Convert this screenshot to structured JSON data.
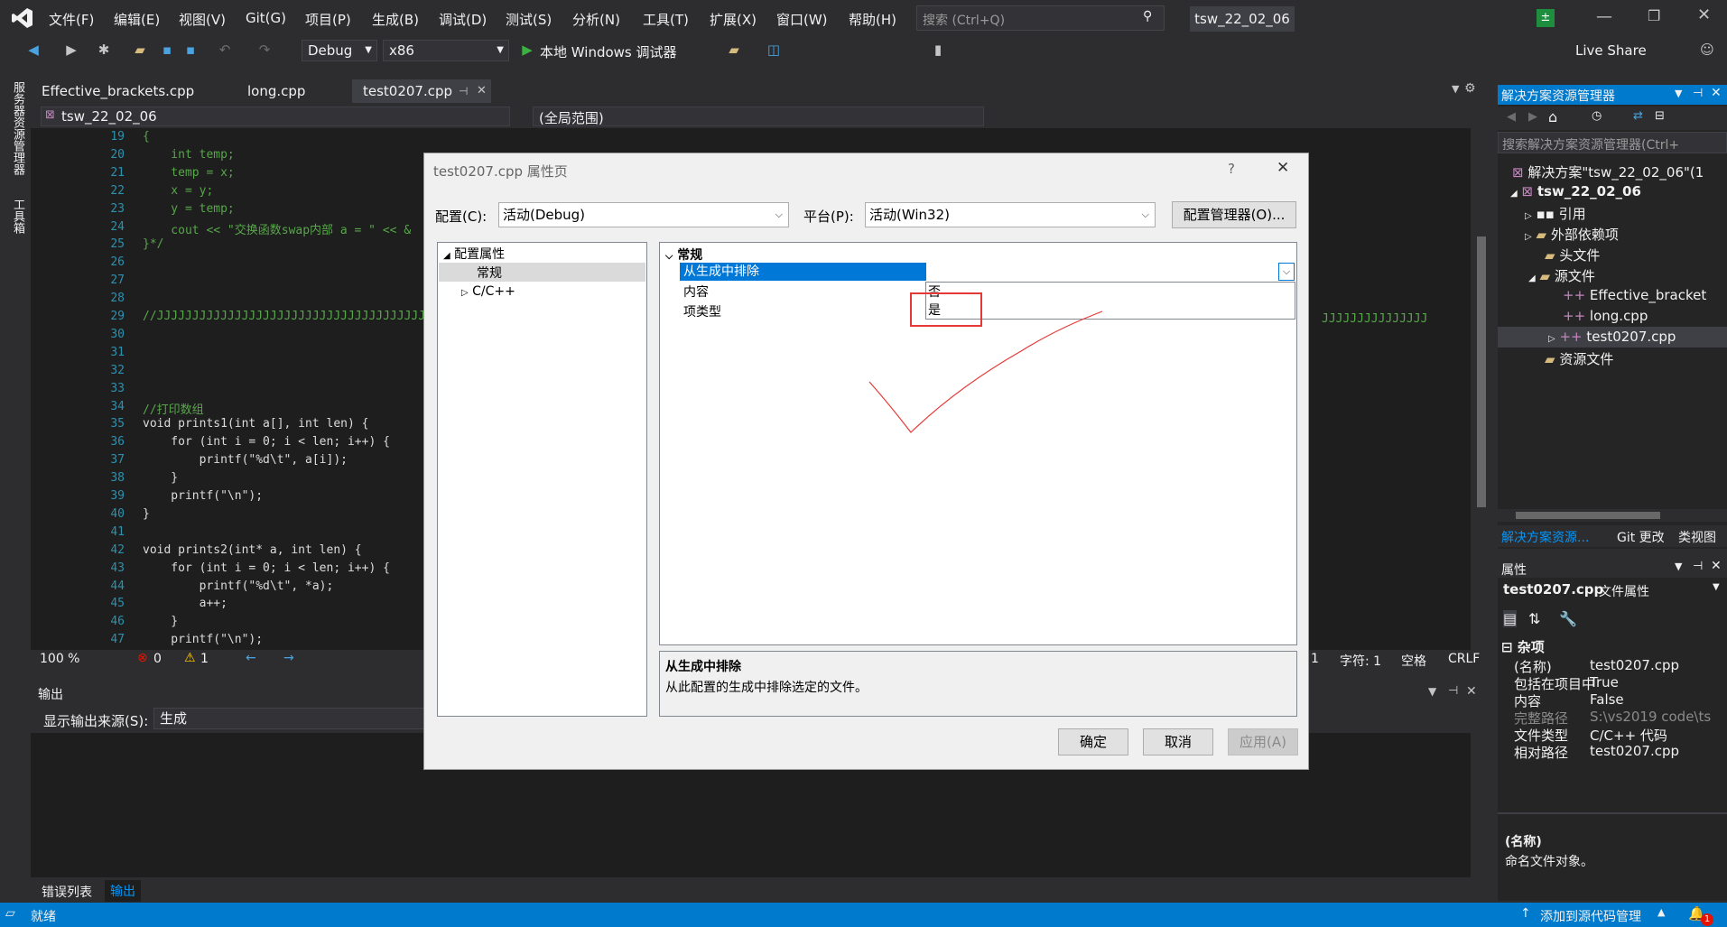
{
  "menu": [
    "文件(F)",
    "编辑(E)",
    "视图(V)",
    "Git(G)",
    "项目(P)",
    "生成(B)",
    "调试(D)",
    "测试(S)",
    "分析(N)",
    "工具(T)",
    "扩展(X)",
    "窗口(W)",
    "帮助(H)"
  ],
  "search": {
    "placeholder": "搜索 (Ctrl+Q)"
  },
  "project_name": "tsw_22_02_06",
  "live_share": "Live Share",
  "toolbar": {
    "config": "Debug",
    "platform": "x86",
    "run": "本地 Windows 调试器"
  },
  "left_strip": {
    "server_explorer": "服务器资源管理器",
    "toolbox": "工具箱"
  },
  "tabs": [
    "Effective_brackets.cpp",
    "long.cpp",
    "test0207.cpp"
  ],
  "nav": {
    "project": "tsw_22_02_06",
    "scope": "(全局范围)"
  },
  "code_lines": [
    {
      "n": "19",
      "t": "{"
    },
    {
      "n": "20",
      "t": "    int temp;"
    },
    {
      "n": "21",
      "t": "    temp = x;"
    },
    {
      "n": "22",
      "t": "    x = y;"
    },
    {
      "n": "23",
      "t": "    y = temp;"
    },
    {
      "n": "24",
      "t": "    cout << \"交换函数swap内部 a = \" << &"
    },
    {
      "n": "25",
      "t": "}*/"
    },
    {
      "n": "26",
      "t": ""
    },
    {
      "n": "27",
      "t": ""
    },
    {
      "n": "28",
      "t": ""
    },
    {
      "n": "29",
      "t": "//JJJJJJJJJJJJJJJJJJJJJJJJJJJJJJJJJJJJJJJ"
    },
    {
      "n": "30",
      "t": ""
    },
    {
      "n": "31",
      "t": ""
    },
    {
      "n": "32",
      "t": ""
    },
    {
      "n": "33",
      "t": ""
    },
    {
      "n": "34",
      "t": "//打印数组"
    },
    {
      "n": "35",
      "t": "void prints1(int a[], int len) {"
    },
    {
      "n": "36",
      "t": "    for (int i = 0; i < len; i++) {"
    },
    {
      "n": "37",
      "t": "        printf(\"%d\\t\", a[i]);"
    },
    {
      "n": "38",
      "t": "    }"
    },
    {
      "n": "39",
      "t": "    printf(\"\\n\");"
    },
    {
      "n": "40",
      "t": "}"
    },
    {
      "n": "41",
      "t": ""
    },
    {
      "n": "42",
      "t": "void prints2(int* a, int len) {"
    },
    {
      "n": "43",
      "t": "    for (int i = 0; i < len; i++) {"
    },
    {
      "n": "44",
      "t": "        printf(\"%d\\t\", *a);"
    },
    {
      "n": "45",
      "t": "        a++;"
    },
    {
      "n": "46",
      "t": "    }"
    },
    {
      "n": "47",
      "t": "    printf(\"\\n\");"
    }
  ],
  "comment_tail": "JJJJJJJJJJJJJJJ",
  "editor_status": {
    "zoom": "100 %",
    "errors": "0",
    "warnings": "1",
    "line": "1",
    "col": "字符: 1",
    "ws": "空格",
    "eol": "CRLF"
  },
  "output": {
    "title": "输出",
    "source_label": "显示输出来源(S):",
    "source_value": "生成",
    "tab_errors": "错误列表",
    "tab_output": "输出"
  },
  "dialog": {
    "title": "test0207.cpp 属性页",
    "help": "?",
    "config_label": "配置(C):",
    "config_value": "活动(Debug)",
    "platform_label": "平台(P):",
    "platform_value": "活动(Win32)",
    "config_manager": "配置管理器(O)...",
    "tree": {
      "root": "配置属性",
      "general": "常规",
      "cpp": "C/C++"
    },
    "grid": {
      "section": "常规",
      "rows": [
        {
          "name": "从生成中排除",
          "value": ""
        },
        {
          "name": "内容",
          "value": ""
        },
        {
          "name": "项类型",
          "value": ""
        }
      ],
      "dropdown": [
        "否",
        "是"
      ]
    },
    "desc_title": "从生成中排除",
    "desc_text": "从此配置的生成中排除选定的文件。",
    "ok": "确定",
    "cancel": "取消",
    "apply": "应用(A)"
  },
  "solution_explorer": {
    "title": "解决方案资源管理器",
    "search": "搜索解决方案资源管理器(Ctrl+",
    "items": [
      {
        "label": "解决方案\"tsw_22_02_06\"(1"
      },
      {
        "label": "tsw_22_02_06"
      },
      {
        "label": "引用"
      },
      {
        "label": "外部依赖项"
      },
      {
        "label": "头文件"
      },
      {
        "label": "源文件"
      },
      {
        "label": "Effective_bracket"
      },
      {
        "label": "long.cpp"
      },
      {
        "label": "test0207.cpp"
      },
      {
        "label": "资源文件"
      }
    ],
    "tabs": [
      "解决方案资源...",
      "Git 更改",
      "类视图"
    ]
  },
  "properties": {
    "title": "属性",
    "object": "test0207.cpp",
    "object_type": "文件属性",
    "section": "杂项",
    "rows": [
      {
        "k": "(名称)",
        "v": "test0207.cpp"
      },
      {
        "k": "包括在项目中",
        "v": "True"
      },
      {
        "k": "内容",
        "v": "False"
      },
      {
        "k": "完整路径",
        "v": "S:\\vs2019 code\\ts"
      },
      {
        "k": "文件类型",
        "v": "C/C++ 代码"
      },
      {
        "k": "相对路径",
        "v": "test0207.cpp"
      }
    ],
    "desc_title": "(名称)",
    "desc_text": "命名文件对象。"
  },
  "status": {
    "ready": "就绪",
    "source_control": "添加到源代码管理",
    "badge": "1"
  },
  "colors": {
    "accent": "#007acc",
    "annotation": "#e53935",
    "selection": "#0078d7"
  }
}
